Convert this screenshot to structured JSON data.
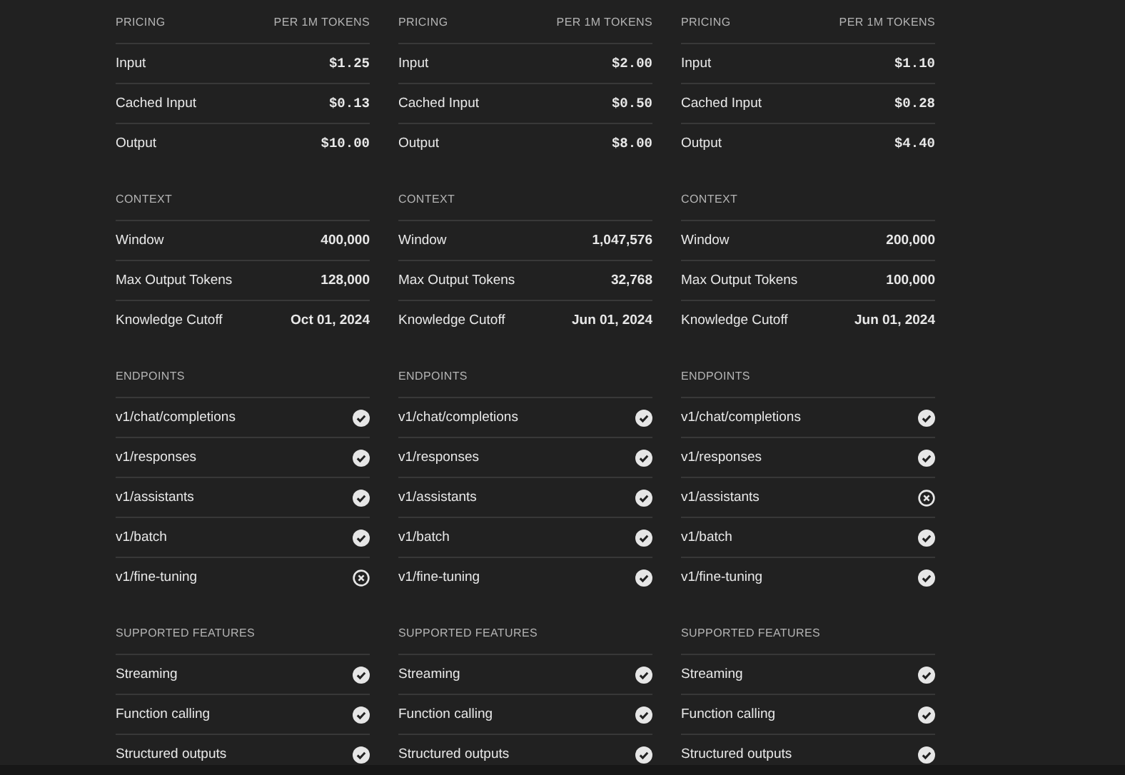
{
  "models": [
    {
      "sections": [
        {
          "kind": "price",
          "title": "PRICING",
          "note": "PER 1M TOKENS",
          "rows": [
            {
              "label": "Input",
              "value": "$1.25"
            },
            {
              "label": "Cached Input",
              "value": "$0.13"
            },
            {
              "label": "Output",
              "value": "$10.00"
            }
          ]
        },
        {
          "kind": "value",
          "title": "CONTEXT",
          "rows": [
            {
              "label": "Window",
              "value": "400,000"
            },
            {
              "label": "Max Output Tokens",
              "value": "128,000"
            },
            {
              "label": "Knowledge Cutoff",
              "value": "Oct 01, 2024"
            }
          ]
        },
        {
          "kind": "support",
          "title": "ENDPOINTS",
          "rows": [
            {
              "label": "v1/chat/completions",
              "supported": true
            },
            {
              "label": "v1/responses",
              "supported": true
            },
            {
              "label": "v1/assistants",
              "supported": true
            },
            {
              "label": "v1/batch",
              "supported": true
            },
            {
              "label": "v1/fine-tuning",
              "supported": false
            }
          ]
        },
        {
          "kind": "support",
          "title": "SUPPORTED FEATURES",
          "rows": [
            {
              "label": "Streaming",
              "supported": true
            },
            {
              "label": "Function calling",
              "supported": true
            },
            {
              "label": "Structured outputs",
              "supported": true
            }
          ]
        }
      ]
    },
    {
      "sections": [
        {
          "kind": "price",
          "title": "PRICING",
          "note": "PER 1M TOKENS",
          "rows": [
            {
              "label": "Input",
              "value": "$2.00"
            },
            {
              "label": "Cached Input",
              "value": "$0.50"
            },
            {
              "label": "Output",
              "value": "$8.00"
            }
          ]
        },
        {
          "kind": "value",
          "title": "CONTEXT",
          "rows": [
            {
              "label": "Window",
              "value": "1,047,576"
            },
            {
              "label": "Max Output Tokens",
              "value": "32,768"
            },
            {
              "label": "Knowledge Cutoff",
              "value": "Jun 01, 2024"
            }
          ]
        },
        {
          "kind": "support",
          "title": "ENDPOINTS",
          "rows": [
            {
              "label": "v1/chat/completions",
              "supported": true
            },
            {
              "label": "v1/responses",
              "supported": true
            },
            {
              "label": "v1/assistants",
              "supported": true
            },
            {
              "label": "v1/batch",
              "supported": true
            },
            {
              "label": "v1/fine-tuning",
              "supported": true
            }
          ]
        },
        {
          "kind": "support",
          "title": "SUPPORTED FEATURES",
          "rows": [
            {
              "label": "Streaming",
              "supported": true
            },
            {
              "label": "Function calling",
              "supported": true
            },
            {
              "label": "Structured outputs",
              "supported": true
            }
          ]
        }
      ]
    },
    {
      "sections": [
        {
          "kind": "price",
          "title": "PRICING",
          "note": "PER 1M TOKENS",
          "rows": [
            {
              "label": "Input",
              "value": "$1.10"
            },
            {
              "label": "Cached Input",
              "value": "$0.28"
            },
            {
              "label": "Output",
              "value": "$4.40"
            }
          ]
        },
        {
          "kind": "value",
          "title": "CONTEXT",
          "rows": [
            {
              "label": "Window",
              "value": "200,000"
            },
            {
              "label": "Max Output Tokens",
              "value": "100,000"
            },
            {
              "label": "Knowledge Cutoff",
              "value": "Jun 01, 2024"
            }
          ]
        },
        {
          "kind": "support",
          "title": "ENDPOINTS",
          "rows": [
            {
              "label": "v1/chat/completions",
              "supported": true
            },
            {
              "label": "v1/responses",
              "supported": true
            },
            {
              "label": "v1/assistants",
              "supported": false
            },
            {
              "label": "v1/batch",
              "supported": true
            },
            {
              "label": "v1/fine-tuning",
              "supported": true
            }
          ]
        },
        {
          "kind": "support",
          "title": "SUPPORTED FEATURES",
          "rows": [
            {
              "label": "Streaming",
              "supported": true
            },
            {
              "label": "Function calling",
              "supported": true
            },
            {
              "label": "Structured outputs",
              "supported": true
            }
          ]
        }
      ]
    }
  ]
}
